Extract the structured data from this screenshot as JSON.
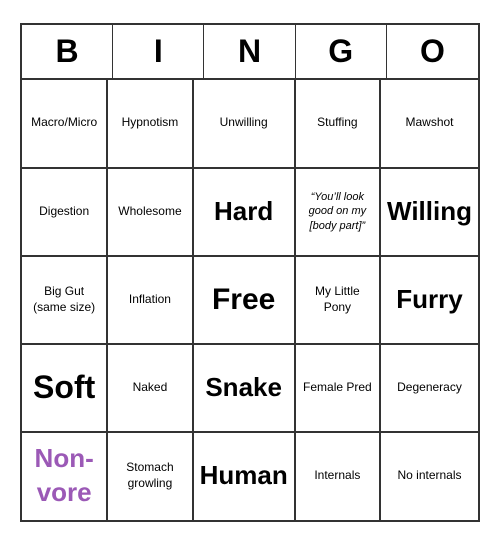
{
  "header": {
    "letters": [
      "B",
      "I",
      "N",
      "G",
      "O"
    ]
  },
  "grid": [
    [
      {
        "text": "Macro/Micro",
        "style": "normal"
      },
      {
        "text": "Hypnotism",
        "style": "normal"
      },
      {
        "text": "Unwilling",
        "style": "normal"
      },
      {
        "text": "Stuffing",
        "style": "normal"
      },
      {
        "text": "Mawshot",
        "style": "normal"
      }
    ],
    [
      {
        "text": "Digestion",
        "style": "normal"
      },
      {
        "text": "Wholesome",
        "style": "normal"
      },
      {
        "text": "Hard",
        "style": "large"
      },
      {
        "text": "“You’ll look good on my [body part]”",
        "style": "quote"
      },
      {
        "text": "Willing",
        "style": "large"
      }
    ],
    [
      {
        "text": "Big Gut (same size)",
        "style": "normal"
      },
      {
        "text": "Inflation",
        "style": "normal"
      },
      {
        "text": "Free",
        "style": "free"
      },
      {
        "text": "My Little Pony",
        "style": "normal"
      },
      {
        "text": "Furry",
        "style": "large"
      }
    ],
    [
      {
        "text": "Soft",
        "style": "xl"
      },
      {
        "text": "Naked",
        "style": "normal"
      },
      {
        "text": "Snake",
        "style": "large"
      },
      {
        "text": "Female Pred",
        "style": "normal"
      },
      {
        "text": "Degeneracy",
        "style": "normal"
      }
    ],
    [
      {
        "text": "Non-vore",
        "style": "nonvore"
      },
      {
        "text": "Stomach growling",
        "style": "normal"
      },
      {
        "text": "Human",
        "style": "large"
      },
      {
        "text": "Internals",
        "style": "normal"
      },
      {
        "text": "No internals",
        "style": "normal"
      }
    ]
  ]
}
